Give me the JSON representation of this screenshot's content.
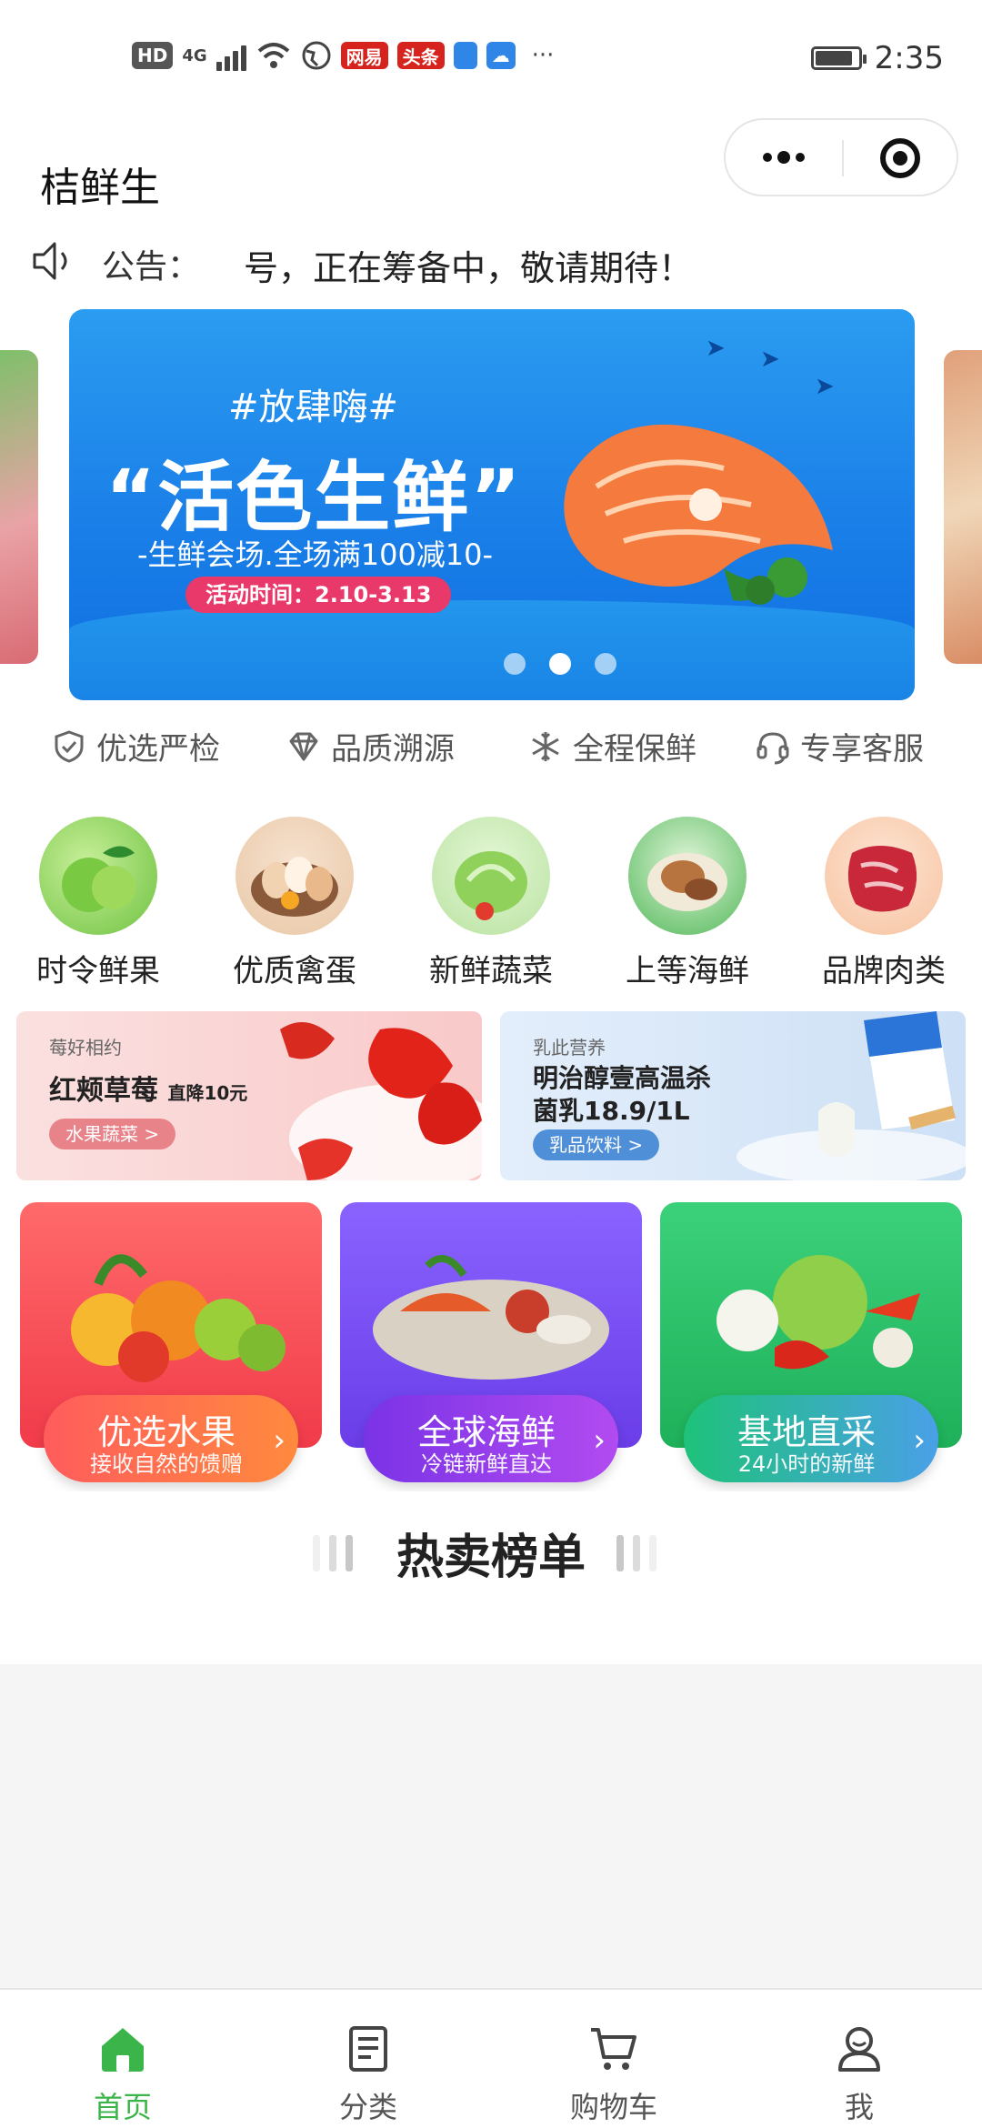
{
  "status_bar": {
    "left_badges": [
      "HD",
      "4G"
    ],
    "app_icons": [
      "网易",
      "头条"
    ],
    "time": "2:35",
    "battery_level": 0.9
  },
  "header": {
    "title": "桔鲜生"
  },
  "notice": {
    "label": "公告：",
    "text": "号，正在筹备中，敬请期待！"
  },
  "banner": {
    "tag": "#放肆嗨#",
    "title": "“活色生鲜”",
    "subtitle": "-生鲜会场.全场满100减10-",
    "time": "活动时间：2.10-3.13",
    "slide_count": 3,
    "active_slide": 1
  },
  "features": [
    {
      "icon": "shield-check-icon",
      "label": "优选严检"
    },
    {
      "icon": "diamond-icon",
      "label": "品质溯源"
    },
    {
      "icon": "snowflake-icon",
      "label": "全程保鲜"
    },
    {
      "icon": "headset-icon",
      "label": "专享客服"
    }
  ],
  "categories": [
    {
      "label": "时令鲜果",
      "icon": "apple-icon"
    },
    {
      "label": "优质禽蛋",
      "icon": "eggs-icon"
    },
    {
      "label": "新鲜蔬菜",
      "icon": "cabbage-icon"
    },
    {
      "label": "上等海鲜",
      "icon": "seafood-icon"
    },
    {
      "label": "品牌肉类",
      "icon": "meat-icon"
    }
  ],
  "promos": [
    {
      "kicker": "莓好相约",
      "title": "红颊草莓",
      "title_extra": "直降10元",
      "tag": "水果蔬菜 >"
    },
    {
      "kicker": "乳此营养",
      "title": "明治醇壹高温杀",
      "title_line2": "菌乳18.9/1L",
      "tag": "乳品饮料 >"
    }
  ],
  "feature_cards": [
    {
      "title": "优选水果",
      "subtitle": "接收自然的馈赠",
      "color": "#f04a55"
    },
    {
      "title": "全球海鲜",
      "subtitle": "冷链新鲜直达",
      "color": "#7b4cf0"
    },
    {
      "title": "基地直采",
      "subtitle": "24小时的新鲜",
      "color": "#2ec46a"
    }
  ],
  "hot_section": {
    "title": "热卖榜单"
  },
  "tabbar": [
    {
      "label": "首页",
      "icon": "home-icon",
      "active": true
    },
    {
      "label": "分类",
      "icon": "list-icon",
      "active": false
    },
    {
      "label": "购物车",
      "icon": "cart-icon",
      "active": false
    },
    {
      "label": "我",
      "icon": "user-icon",
      "active": false
    }
  ],
  "colors": {
    "accent": "#3bb54a",
    "banner_blue": "#1a7fe8",
    "time_pill": "#e9396a"
  }
}
